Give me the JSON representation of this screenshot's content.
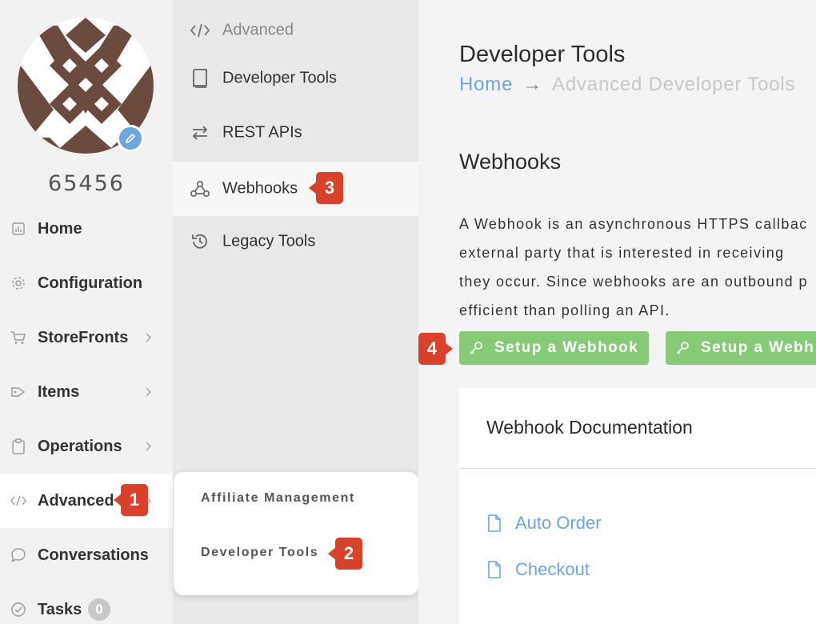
{
  "user": {
    "id": "65456"
  },
  "nav": {
    "items": [
      {
        "label": "Home",
        "icon": "chart-icon"
      },
      {
        "label": "Configuration",
        "icon": "gear-icon"
      },
      {
        "label": "StoreFronts",
        "icon": "cart-icon"
      },
      {
        "label": "Items",
        "icon": "tags-icon"
      },
      {
        "label": "Operations",
        "icon": "clipboard-icon"
      },
      {
        "label": "Advanced",
        "icon": "code-icon"
      },
      {
        "label": "Conversations",
        "icon": "chat-icon"
      },
      {
        "label": "Tasks",
        "icon": "check-circle-icon",
        "badge": "0"
      }
    ]
  },
  "subnav": {
    "header": "Advanced",
    "items": [
      {
        "label": "Developer Tools",
        "icon": "book-icon"
      },
      {
        "label": "REST APIs",
        "icon": "swap-icon"
      },
      {
        "label": "Webhooks",
        "icon": "webhook-icon"
      },
      {
        "label": "Legacy Tools",
        "icon": "history-icon"
      }
    ]
  },
  "flyout": {
    "items": [
      "Affiliate Management",
      "Developer Tools"
    ]
  },
  "main": {
    "title": "Developer Tools",
    "breadcrumb": {
      "home": "Home",
      "arrow": "→",
      "current": "Advanced Developer Tools"
    },
    "section_title": "Webhooks",
    "description": [
      "A Webhook is an asynchronous HTTPS callbac",
      "external party that is interested in receiving",
      "they occur. Since webhooks are an outbound p",
      "efficient than polling an API."
    ],
    "buttons": [
      "Setup a Webhook",
      "Setup a Webh"
    ],
    "card": {
      "title": "Webhook Documentation",
      "links": [
        "Auto Order",
        "Checkout"
      ]
    }
  },
  "callouts": [
    "1",
    "2",
    "3",
    "4"
  ],
  "colors": {
    "accent_blue": "#6ea6dc",
    "button_green": "#86cc77",
    "callout_red": "#d9412a",
    "avatar_brown": "#6b4a3f"
  }
}
